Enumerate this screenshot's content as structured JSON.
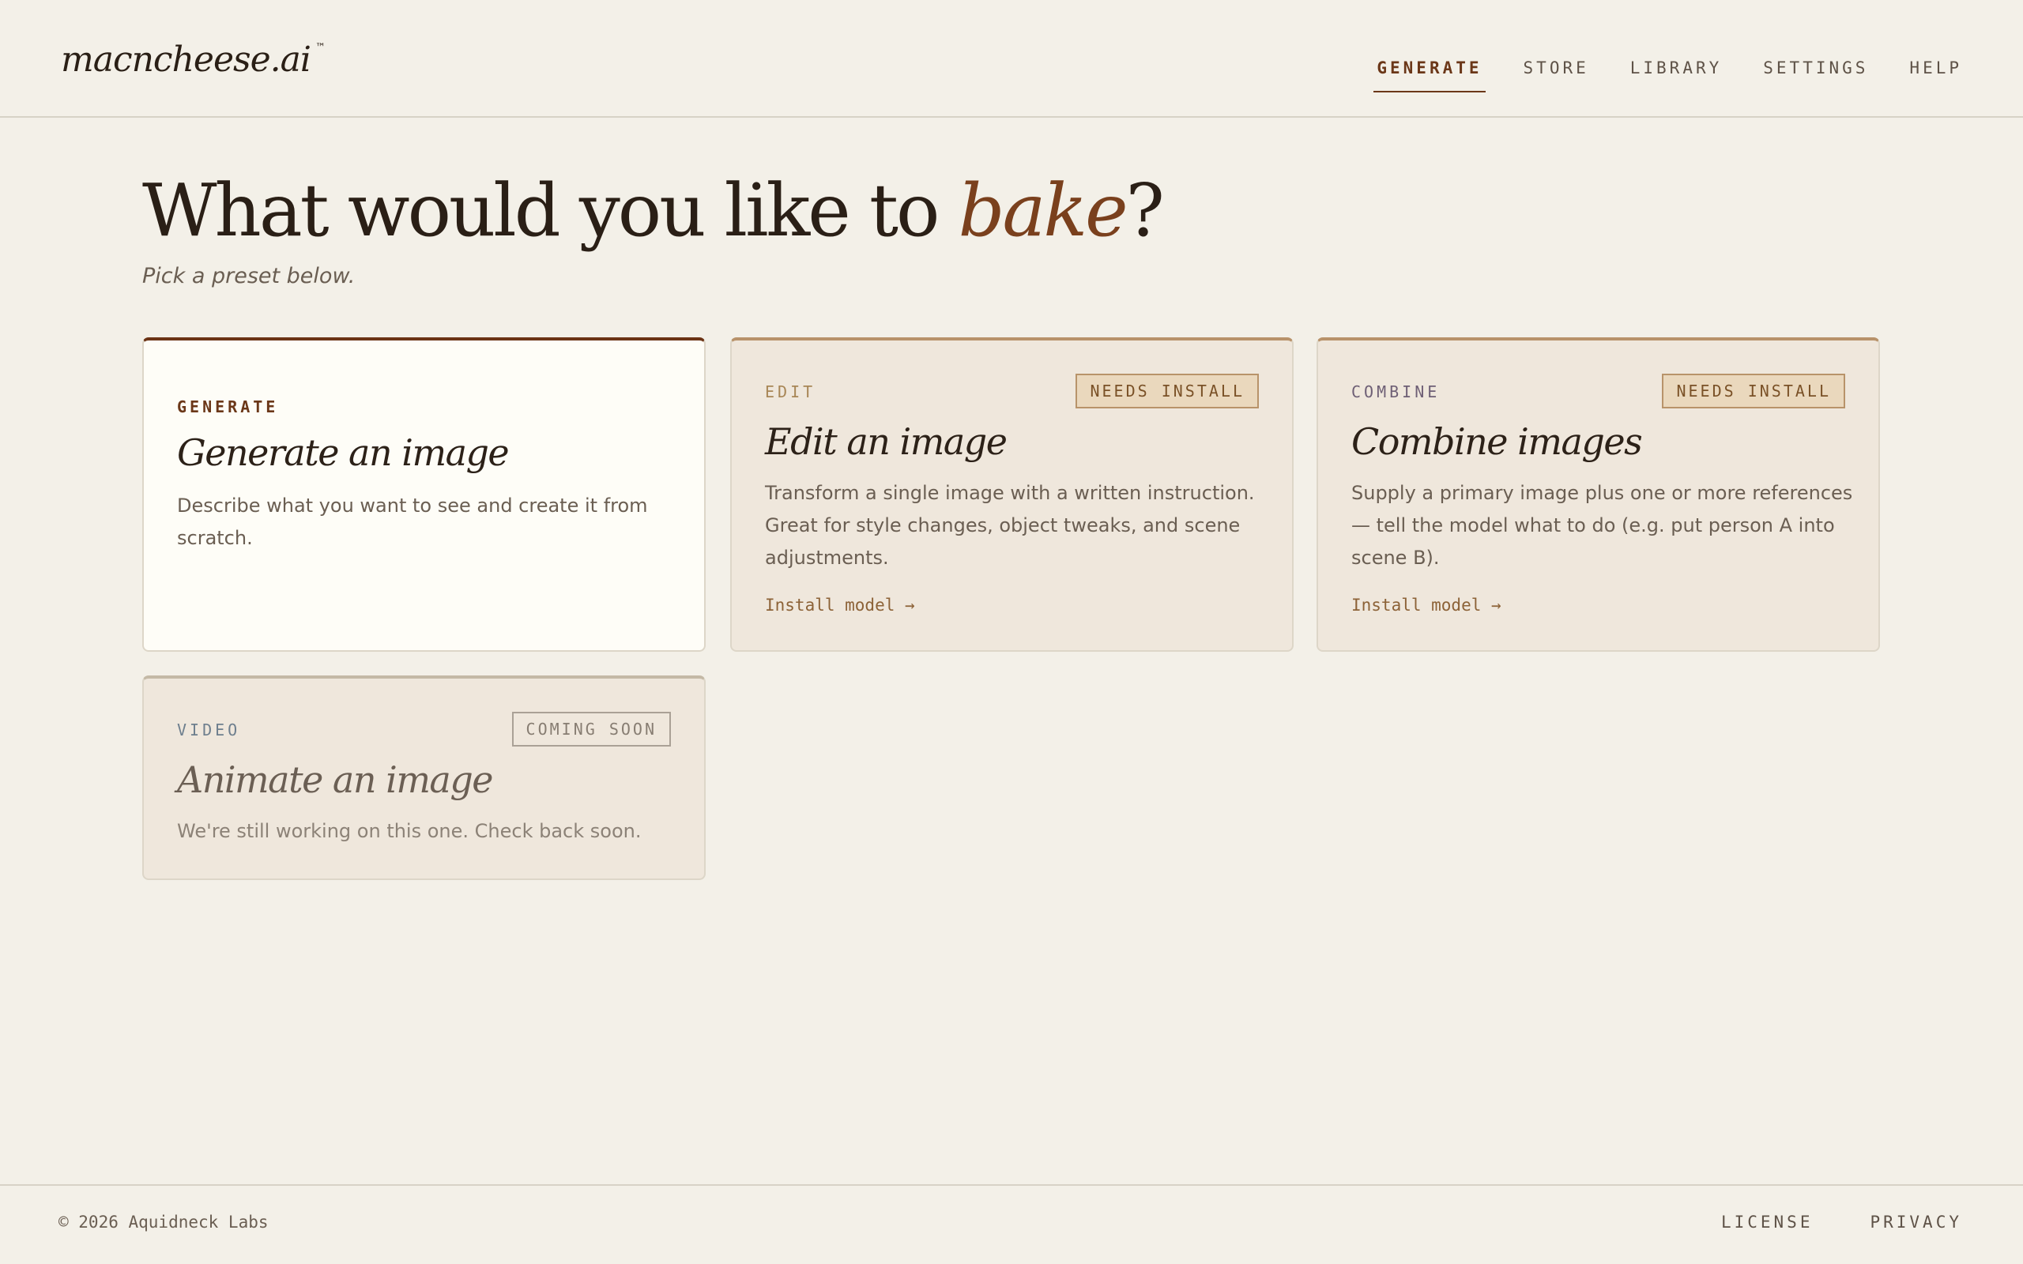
{
  "app": {
    "logo": "macncheese.ai",
    "trademark": "™"
  },
  "nav": {
    "items": [
      {
        "label": "GENERATE",
        "active": true
      },
      {
        "label": "STORE",
        "active": false
      },
      {
        "label": "LIBRARY",
        "active": false
      },
      {
        "label": "SETTINGS",
        "active": false
      },
      {
        "label": "HELP",
        "active": false
      }
    ]
  },
  "hero": {
    "title_prefix": "What would you like to ",
    "title_accent": "bake",
    "title_suffix": "?",
    "subtitle": "Pick a preset below."
  },
  "colors": {
    "background": "#f3f0e8",
    "accent": "#7a401d",
    "selected_card_bg": "#fefdf7",
    "card_bg": "#efe7dc",
    "tag_generate": "#6b3718",
    "tag_edit": "#a88656",
    "tag_combine": "#6e5f75",
    "tag_video": "#6e7f8e"
  },
  "cards": [
    {
      "tag": "GENERATE",
      "title": "Generate an image",
      "description": "Describe what you want to see and create it from scratch.",
      "badge": "",
      "link": "",
      "selected": true
    },
    {
      "tag": "EDIT",
      "title": "Edit an image",
      "description": "Transform a single image with a written instruction. Great for style changes, object tweaks, and scene adjustments.",
      "badge": "NEEDS INSTALL",
      "link": "Install model →",
      "selected": false
    },
    {
      "tag": "COMBINE",
      "title": "Combine images",
      "description": "Supply a primary image plus one or more references — tell the model what to do (e.g. put person A into scene B).",
      "badge": "NEEDS INSTALL",
      "link": "Install model →",
      "selected": false
    },
    {
      "tag": "VIDEO",
      "title": "Animate an image",
      "description": "We're still working on this one. Check back soon.",
      "badge": "COMING SOON",
      "link": "",
      "selected": false
    }
  ],
  "footer": {
    "copyright": "© 2026 Aquidneck Labs",
    "links": [
      "LICENSE",
      "PRIVACY"
    ]
  }
}
